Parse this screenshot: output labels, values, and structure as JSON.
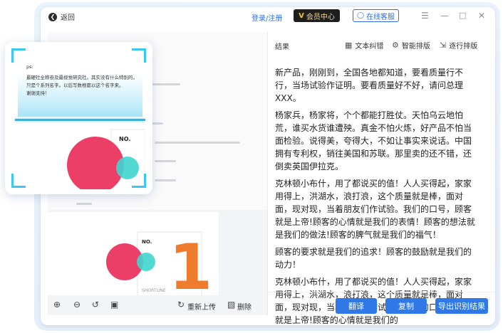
{
  "titlebar": {
    "back_label": "返回",
    "login_label": "登录/注册",
    "vip_label": "会员中心",
    "vip_logo": "V",
    "service_label": "在线客服"
  },
  "left_toolbar": {
    "reupload_label": "重新上传",
    "delete_label": "删除"
  },
  "document": {
    "card_label": "NO.",
    "brand_text": "SHORTLINE",
    "big_number": "1"
  },
  "scan_card": {
    "lines": [
      "ps:",
      "最硬社全称叁及最视觉研究社。其实没有什么特别的。",
      "只是个系列名字。以后写数根都以这个名字来。",
      "谢谢支持！"
    ]
  },
  "result": {
    "title": "结果",
    "tools": {
      "correct": "文本纠错",
      "smart": "智能排版",
      "line": "逐行排版"
    },
    "paragraphs": [
      "新产品，刚刚到，全国各地都知道，要看质量行不行，当场试验作证明。要看质量好不好，请问总理XXX。",
      "杨家兵，杨家将，个个都能打胜仗。天怕乌云地怕荒，谁买水货谁遭殃。真金不怕火炼，好产品不怕当面检验。说得美，夸得大，不如让事实来说话。中国拥有专利权，销往美国和苏联。那里卖的还不错，还倒卖英国伊拉克。",
      "克林顿小布什，用了都说买的值！人人买得起，家家用得上，洪湖水，浪打浪，这个质量就是棒，面对面，现对现，当着朋友们作试验。我们的口号，顾客就是上帝!顾客的心情就是我们的表情！顾客的想法就是我们的做法!顾客的脾气就是我们的福气！",
      "顾客的要求就是我们的追求！顾客的鼓励就是我们的动力！",
      "克林顿小布什，用了都说买的值！人人买得起，家家用得上，洪湖水，浪打浪，这个质量就是棒，面对面，现对现，当着朋友们作试验。我们的口号，顾客就是上帝!顾客的心情就是我们的"
    ],
    "translate_label": "翻译",
    "copy_label": "复制",
    "export_label": "导出识别结果"
  },
  "colors": {
    "accent": "#3078e6",
    "scan": "#1fbbe9",
    "vip_bg": "#1e1e1e"
  }
}
